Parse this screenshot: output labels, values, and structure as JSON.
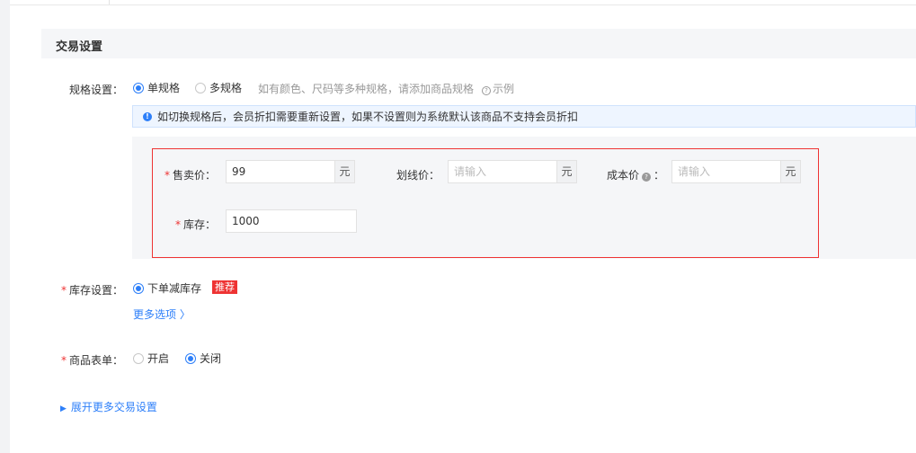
{
  "section": {
    "title": "交易设置"
  },
  "spec": {
    "label": "规格设置：",
    "options": [
      {
        "label": "单规格",
        "selected": true
      },
      {
        "label": "多规格",
        "selected": false
      }
    ],
    "hint": "如有颜色、尺码等多种规格，请添加商品规格",
    "example_label": "示例",
    "info": "如切换规格后，会员折扣需要重新设置，如果不设置则为系统默认该商品不支持会员折扣"
  },
  "fields": {
    "price": {
      "label": "售卖价：",
      "value": "99",
      "unit": "元"
    },
    "original_price": {
      "label": "划线价：",
      "placeholder": "请输入",
      "unit": "元"
    },
    "cost_price": {
      "label": "成本价",
      "colon": "：",
      "placeholder": "请输入",
      "unit": "元"
    },
    "stock": {
      "label": "库存：",
      "value": "1000"
    }
  },
  "inventory": {
    "label": "库存设置：",
    "option": {
      "label": "下单减库存",
      "selected": true
    },
    "badge": "推荐",
    "more_link": "更多选项 〉"
  },
  "form": {
    "label": "商品表单：",
    "options": [
      {
        "label": "开启",
        "selected": false
      },
      {
        "label": "关闭",
        "selected": true
      }
    ]
  },
  "expand": {
    "label": "展开更多交易设置"
  },
  "required_mark": "*",
  "colors": {
    "accent": "#2d7ff9",
    "required": "#e33333"
  }
}
